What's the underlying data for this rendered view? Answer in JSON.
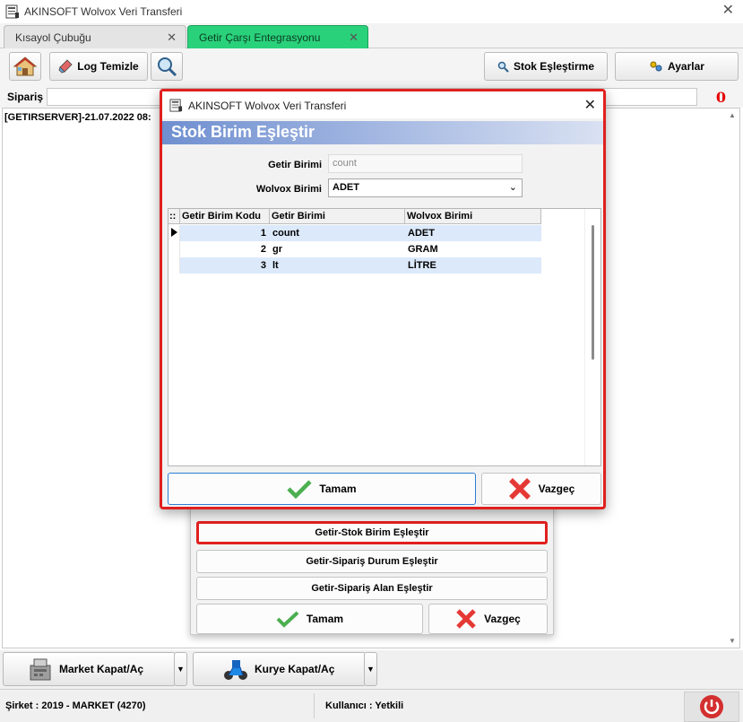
{
  "window": {
    "title": "AKINSOFT Wolvox Veri Transferi",
    "close_glyph": "✕"
  },
  "tabs": [
    {
      "label": "Kısayol Çubuğu",
      "close": "✕"
    },
    {
      "label": "Getir Çarşı Entegrasyonu",
      "close": "✕"
    }
  ],
  "toolbar": {
    "log_clear_label": "Log Temizle",
    "stock_match_label": "Stok Eşleştirme",
    "settings_label": "Ayarlar"
  },
  "order": {
    "label": "Sipariş",
    "count": "0"
  },
  "log": {
    "line": "[GETIRSERVER]-21.07.2022 08:"
  },
  "background_dialog": {
    "buttons": [
      "Getir-Stok Birim Eşleştir",
      "Getir-Sipariş Durum Eşleştir",
      "Getir-Sipariş Alan Eşleştir"
    ],
    "ok_label": "Tamam",
    "cancel_label": "Vazgeç"
  },
  "modal": {
    "title": "AKINSOFT Wolvox Veri Transferi",
    "header": "Stok Birim Eşleştir",
    "getir_label": "Getir Birimi",
    "getir_value": "count",
    "wolvox_label": "Wolvox Birimi",
    "wolvox_value": "ADET",
    "grid": {
      "indicator_header": "::",
      "columns": [
        "Getir Birim Kodu",
        "Getir Birimi",
        "Wolvox Birimi"
      ],
      "rows": [
        {
          "code": "1",
          "getir": "count",
          "wolvox": "ADET"
        },
        {
          "code": "2",
          "getir": "gr",
          "wolvox": "GRAM"
        },
        {
          "code": "3",
          "getir": "lt",
          "wolvox": "LİTRE"
        }
      ]
    },
    "ok_label": "Tamam",
    "cancel_label": "Vazgeç"
  },
  "bottom": {
    "market_label": "Market Kapat/Aç",
    "courier_label": "Kurye Kapat/Aç",
    "dropdown_glyph": "▼"
  },
  "status": {
    "company": "Şirket : 2019 - MARKET (4270)",
    "user": "Kullanıcı : Yetkili"
  },
  "colors": {
    "accent_green": "#2ad17b",
    "highlight_red": "#e0201e",
    "row_blue": "#dbe9fb",
    "count_red": "#e60000"
  }
}
